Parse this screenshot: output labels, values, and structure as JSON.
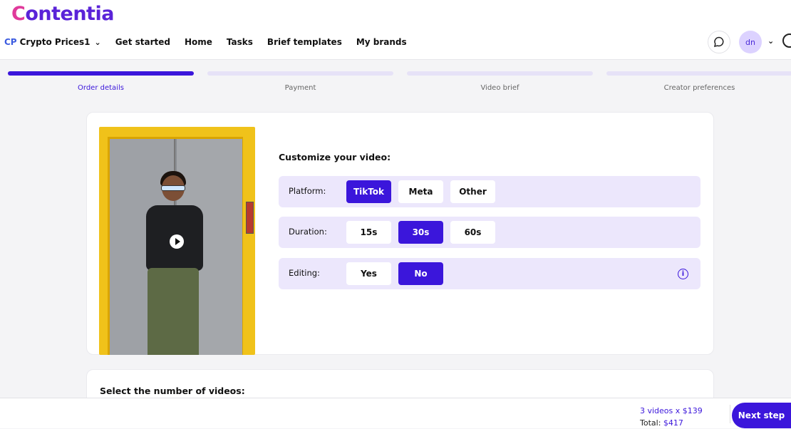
{
  "app": {
    "logo_first": "C",
    "logo_rest": "ontentia"
  },
  "nav": {
    "brand_badge": "CP",
    "brand_name": "Crypto Prices1",
    "links": [
      "Get started",
      "Home",
      "Tasks",
      "Brief templates",
      "My brands"
    ]
  },
  "user": {
    "initials": "dn"
  },
  "steps": [
    {
      "label": "Order details",
      "active": true
    },
    {
      "label": "Payment",
      "active": false
    },
    {
      "label": "Video brief",
      "active": false
    },
    {
      "label": "Creator preferences",
      "active": false
    }
  ],
  "customize": {
    "title": "Customize your video:",
    "rows": [
      {
        "label": "Platform:",
        "options": [
          "TikTok",
          "Meta",
          "Other"
        ],
        "selected": "TikTok"
      },
      {
        "label": "Duration:",
        "options": [
          "15s",
          "30s",
          "60s"
        ],
        "selected": "30s"
      },
      {
        "label": "Editing:",
        "options": [
          "Yes",
          "No"
        ],
        "selected": "No"
      }
    ]
  },
  "videos_section": {
    "title": "Select the number of videos:"
  },
  "footer": {
    "summary_line": "3 videos x $139",
    "total_label": "Total:",
    "total_value": "$417",
    "next_label": "Next step"
  },
  "colors": {
    "accent": "#3b16db",
    "logo_pink": "#e03a9b",
    "logo_purple": "#5a23d8",
    "row_bg": "#ece7fc"
  },
  "icons": {
    "chat": "chat-bubble-icon",
    "play": "play-icon",
    "info": "info-icon",
    "chevron": "chevron-down-icon",
    "help": "help-icon"
  }
}
